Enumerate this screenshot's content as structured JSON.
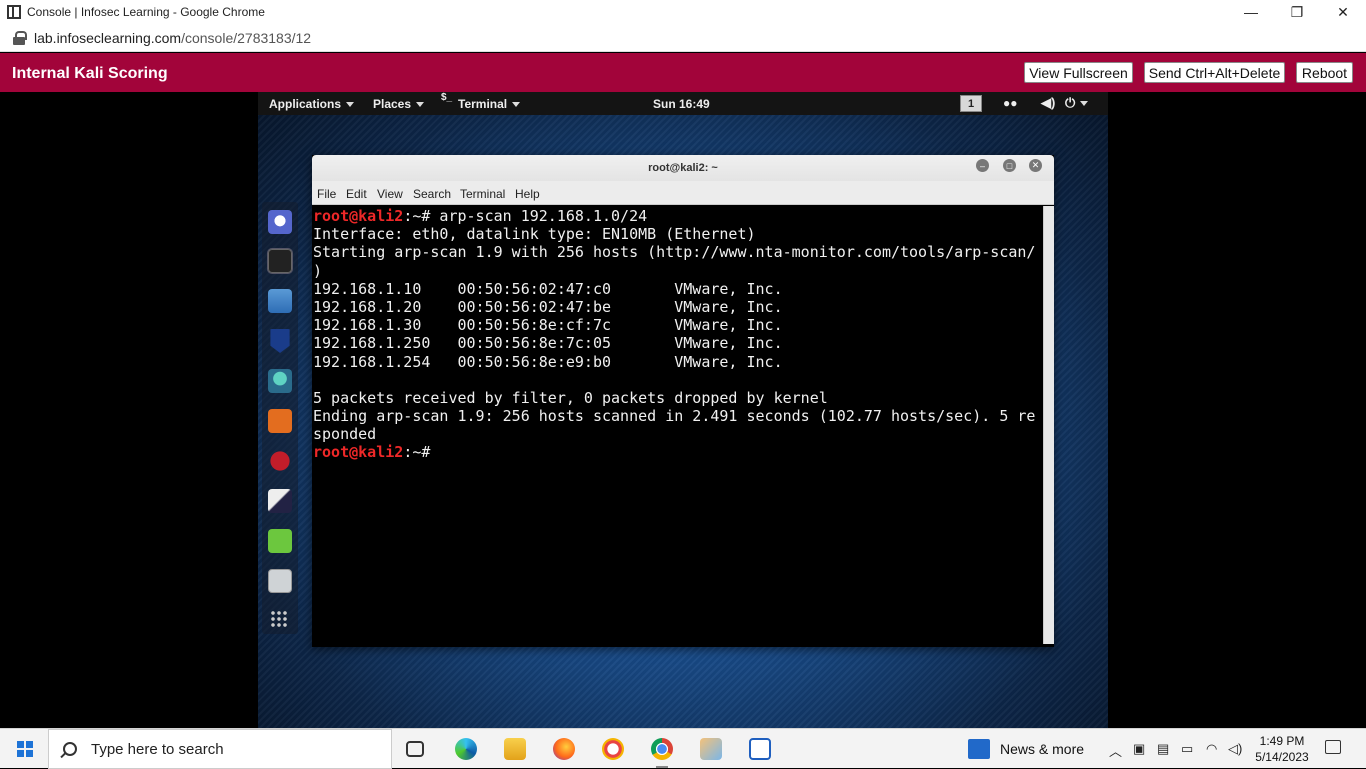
{
  "browser": {
    "title": "Console | Infosec Learning - Google Chrome",
    "url_host": "lab.infoseclearning.com",
    "url_path": "/console/2783183/12",
    "controls": {
      "minimize": "—",
      "restore": "❐",
      "close": "✕"
    }
  },
  "header": {
    "brand": "Internal Kali Scoring",
    "buttons": {
      "fullscreen": "View Fullscreen",
      "ctrl_alt_del": "Send Ctrl+Alt+Delete",
      "reboot": "Reboot"
    },
    "accent": "#a2043a"
  },
  "kali": {
    "topbar": {
      "applications": "Applications",
      "places": "Places",
      "terminal": "Terminal",
      "clock": "Sun 16:49",
      "workspace": "1"
    },
    "dock_icons": [
      "kali-icon",
      "terminal-icon",
      "files-icon",
      "metasploit-icon",
      "armitage-icon",
      "burpsuite-icon",
      "beef-icon",
      "faraday-icon",
      "notes-icon",
      "screenshot-icon",
      "show-apps-icon"
    ]
  },
  "terminal": {
    "title": "root@kali2: ~",
    "menu": {
      "file": "File",
      "edit": "Edit",
      "view": "View",
      "search": "Search",
      "terminal": "Terminal",
      "help": "Help"
    },
    "prompt_user": "root@kali2",
    "prompt_path": ":~#",
    "command": " arp-scan 192.168.1.0/24",
    "output": [
      "Interface: eth0, datalink type: EN10MB (Ethernet)",
      "Starting arp-scan 1.9 with 256 hosts (http://www.nta-monitor.com/tools/arp-scan/",
      ")",
      "192.168.1.10    00:50:56:02:47:c0       VMware, Inc.",
      "192.168.1.20    00:50:56:02:47:be       VMware, Inc.",
      "192.168.1.30    00:50:56:8e:cf:7c       VMware, Inc.",
      "192.168.1.250   00:50:56:8e:7c:05       VMware, Inc.",
      "192.168.1.254   00:50:56:8e:e9:b0       VMware, Inc.",
      "",
      "5 packets received by filter, 0 packets dropped by kernel",
      "Ending arp-scan 1.9: 256 hosts scanned in 2.491 seconds (102.77 hosts/sec). 5 re",
      "sponded"
    ]
  },
  "taskbar": {
    "search_placeholder": "Type here to search",
    "news": "News & more",
    "time": "1:49 PM",
    "date": "5/14/2023"
  }
}
